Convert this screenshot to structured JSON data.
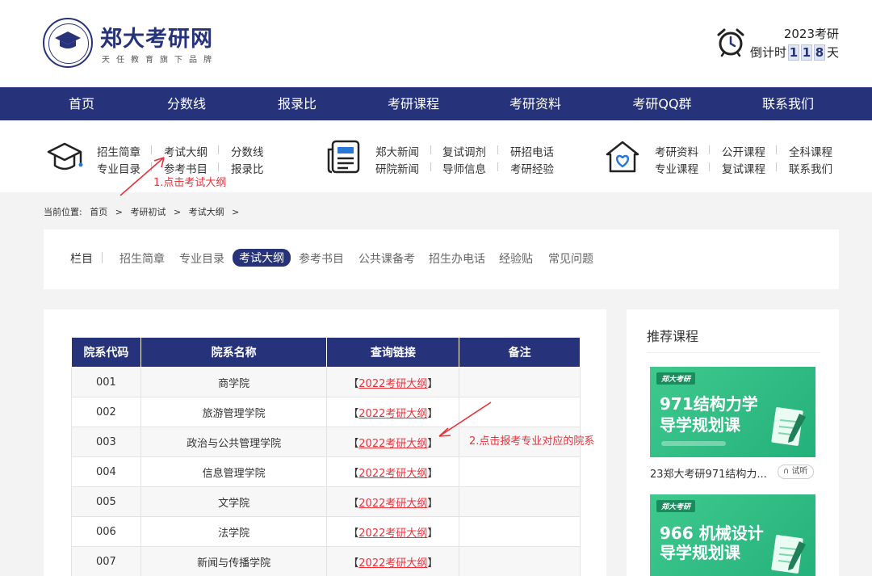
{
  "header": {
    "logo_name": "郑大考研网",
    "logo_sub": "天任教育旗下品牌",
    "exam_year": "2023考研",
    "countdown_prefix": "倒计时",
    "countdown_digits": [
      "1",
      "1",
      "8"
    ],
    "countdown_suffix": "天"
  },
  "nav": [
    "首页",
    "分数线",
    "报录比",
    "考研课程",
    "考研资料",
    "考研QQ群",
    "联系我们"
  ],
  "subnav": {
    "group1": [
      "招生简章",
      "考试大纲",
      "分数线",
      "专业目录",
      "参考书目",
      "报录比"
    ],
    "group2": [
      "郑大新闻",
      "复试调剂",
      "研招电话",
      "研院新闻",
      "导师信息",
      "考研经验"
    ],
    "group3": [
      "考研资料",
      "公开课程",
      "全科课程",
      "专业课程",
      "复试课程",
      "联系我们"
    ]
  },
  "annotations": {
    "step1": "1.点击考试大纲",
    "step2": "2.点击报考专业对应的院系"
  },
  "breadcrumb": [
    "当前位置:",
    "首页",
    ">",
    "考研初试",
    ">",
    "考试大纲",
    ">"
  ],
  "category": {
    "label": "栏目",
    "items": [
      "招生简章",
      "专业目录",
      "考试大纲",
      "参考书目",
      "公共课备考",
      "招生办电话",
      "经验贴",
      "常见问题"
    ],
    "active": "考试大纲"
  },
  "table": {
    "headers": [
      "院系代码",
      "院系名称",
      "查询链接",
      "备注"
    ],
    "rows": [
      {
        "code": "001",
        "name": "商学院",
        "link": "2022考研大纲",
        "note": ""
      },
      {
        "code": "002",
        "name": "旅游管理学院",
        "link": "2022考研大纲",
        "note": ""
      },
      {
        "code": "003",
        "name": "政治与公共管理学院",
        "link": "2022考研大纲",
        "note": ""
      },
      {
        "code": "004",
        "name": "信息管理学院",
        "link": "2022考研大纲",
        "note": ""
      },
      {
        "code": "005",
        "name": "文学院",
        "link": "2022考研大纲",
        "note": ""
      },
      {
        "code": "006",
        "name": "法学院",
        "link": "2022考研大纲",
        "note": ""
      },
      {
        "code": "007",
        "name": "新闻与传播学院",
        "link": "2022考研大纲",
        "note": ""
      }
    ],
    "bracket_open": "【",
    "bracket_close": "】"
  },
  "sidebar": {
    "title": "推荐课程",
    "courses": [
      {
        "badge": "郑大考研",
        "line1": "971结构力学",
        "line2": "导学规划课",
        "caption": "23郑大考研971结构力...",
        "trial": "试听"
      },
      {
        "badge": "郑大考研",
        "line1": "966 机械设计",
        "line2": "导学规划课",
        "caption": "",
        "trial": ""
      }
    ]
  },
  "colors": {
    "brand": "#26337a",
    "link": "#e8333a",
    "course_card": "#2fbd85"
  }
}
